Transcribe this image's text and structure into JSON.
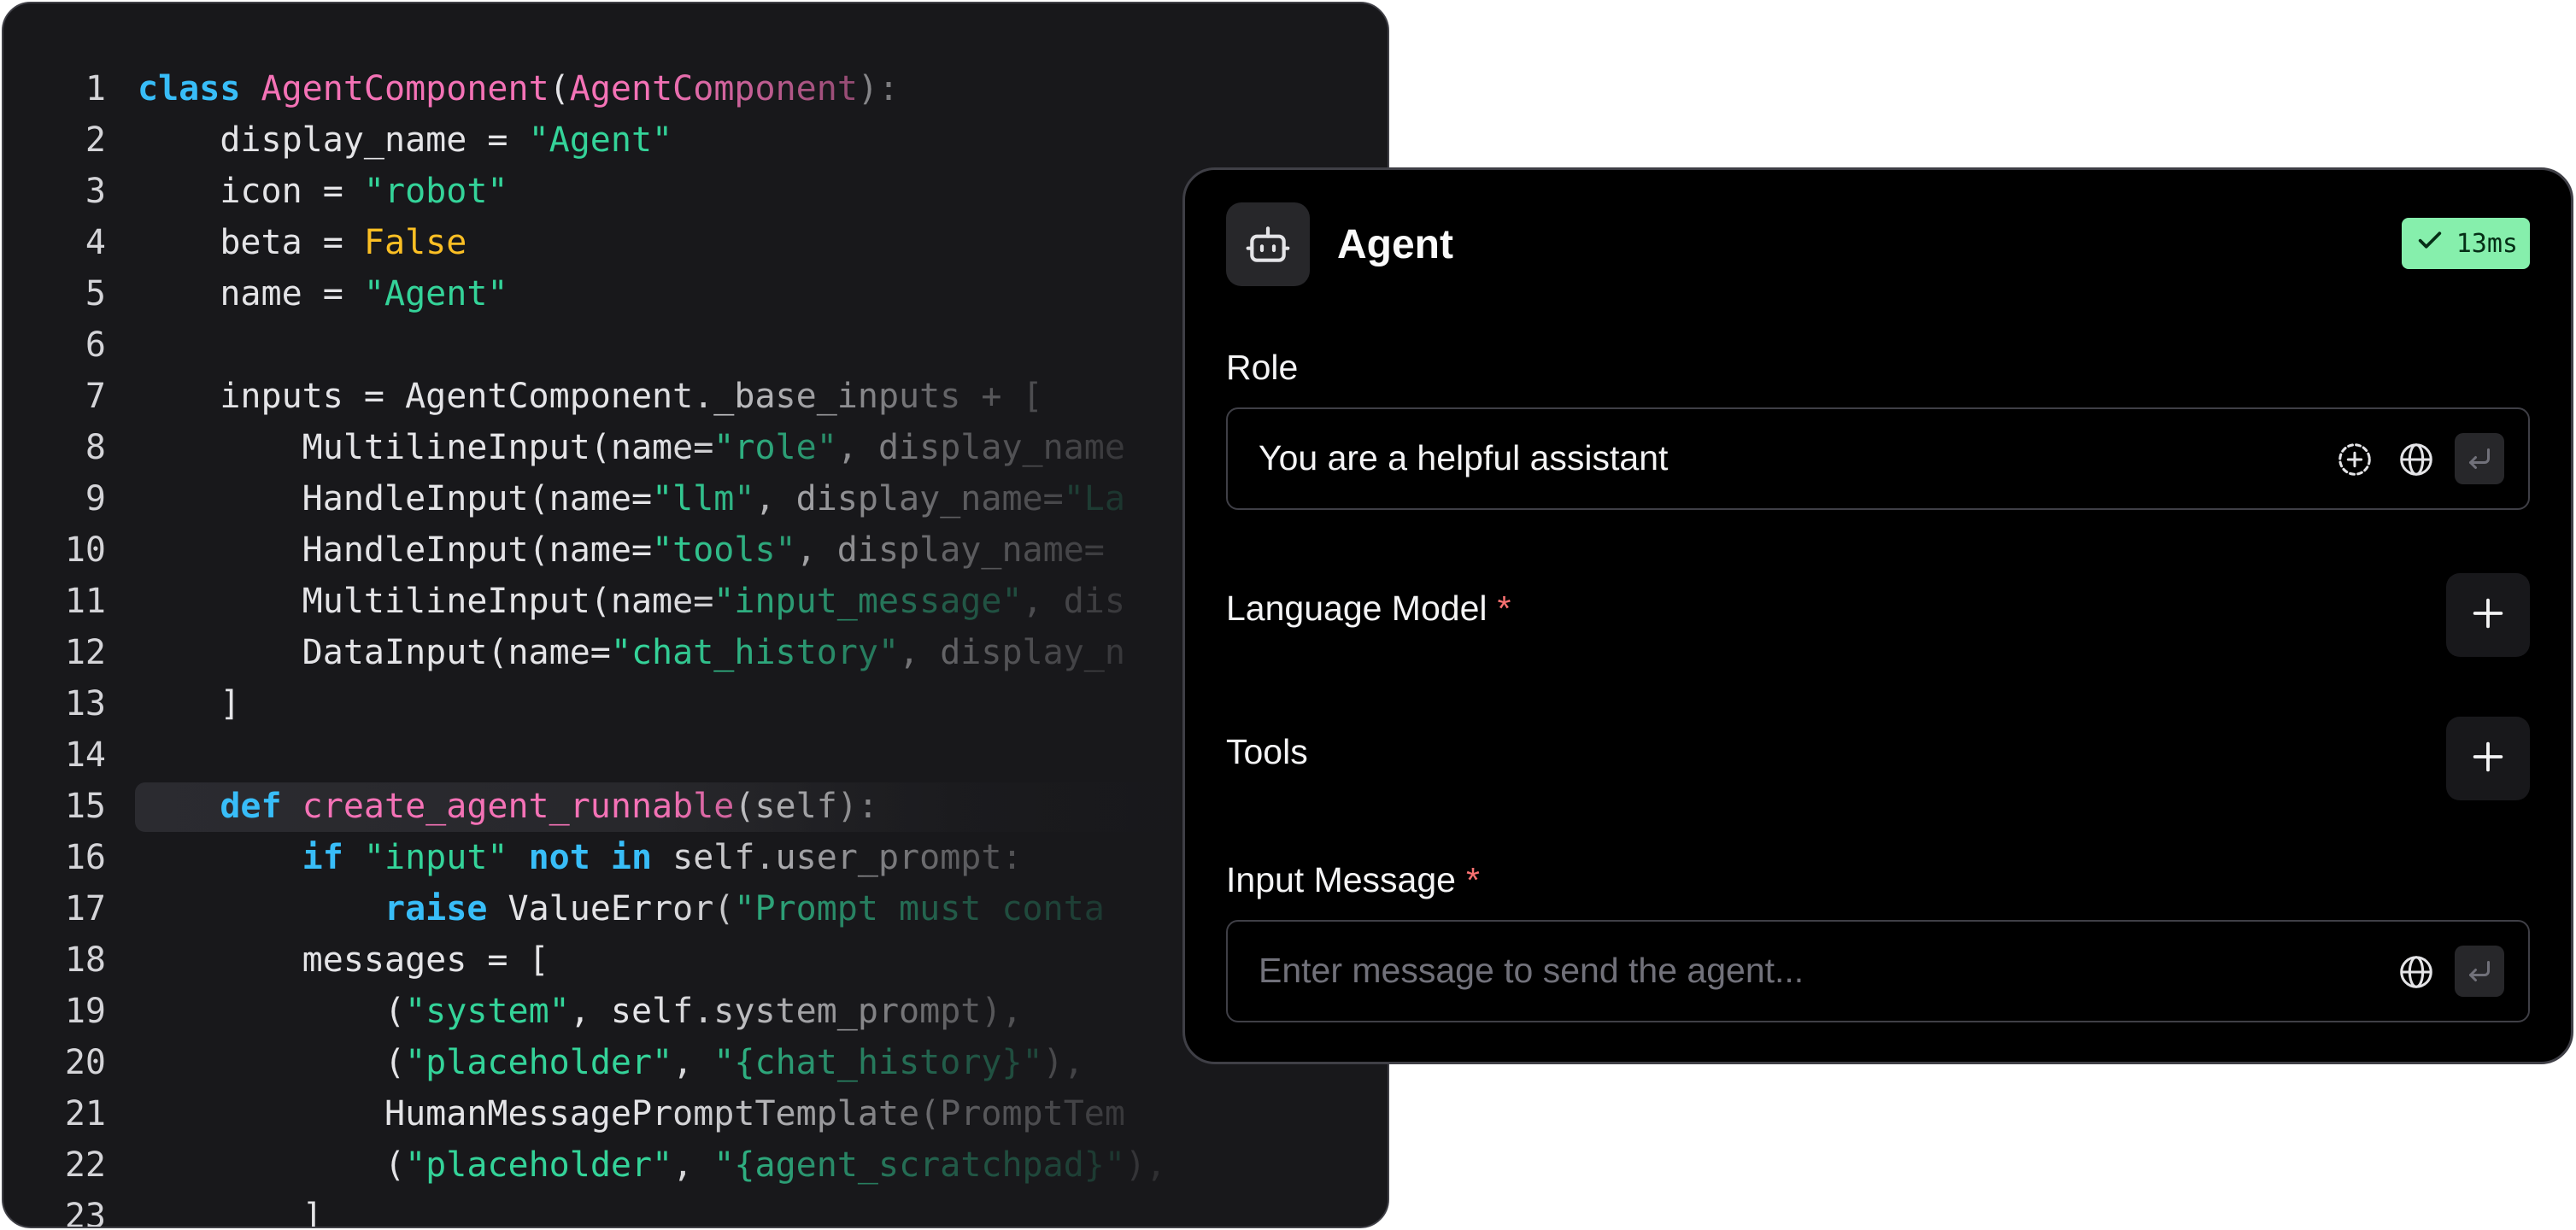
{
  "code": {
    "lines": [
      {
        "num": "1",
        "tokens": [
          {
            "t": "class ",
            "c": "kw"
          },
          {
            "t": "AgentComponent",
            "c": "fn"
          },
          {
            "t": "(",
            "c": "pl"
          },
          {
            "t": "AgentComponent",
            "c": "fn"
          },
          {
            "t": "):",
            "c": "pl"
          }
        ]
      },
      {
        "num": "2",
        "tokens": [
          {
            "t": "    display_name = ",
            "c": "pl"
          },
          {
            "t": "\"Agent\"",
            "c": "st"
          }
        ]
      },
      {
        "num": "3",
        "tokens": [
          {
            "t": "    icon = ",
            "c": "pl"
          },
          {
            "t": "\"robot\"",
            "c": "st"
          }
        ]
      },
      {
        "num": "4",
        "tokens": [
          {
            "t": "    beta = ",
            "c": "pl"
          },
          {
            "t": "False",
            "c": "bl"
          }
        ]
      },
      {
        "num": "5",
        "tokens": [
          {
            "t": "    name = ",
            "c": "pl"
          },
          {
            "t": "\"Agent\"",
            "c": "st"
          }
        ]
      },
      {
        "num": "6",
        "tokens": []
      },
      {
        "num": "7",
        "tokens": [
          {
            "t": "    inputs = AgentComponent._base_inputs + [",
            "c": "pl"
          }
        ]
      },
      {
        "num": "8",
        "tokens": [
          {
            "t": "        MultilineInput(name=",
            "c": "pl"
          },
          {
            "t": "\"role\"",
            "c": "st"
          },
          {
            "t": ", display_name",
            "c": "pl"
          }
        ]
      },
      {
        "num": "9",
        "tokens": [
          {
            "t": "        HandleInput(name=",
            "c": "pl"
          },
          {
            "t": "\"llm\"",
            "c": "st"
          },
          {
            "t": ", display_name=",
            "c": "pl"
          },
          {
            "t": "\"La",
            "c": "st"
          }
        ]
      },
      {
        "num": "10",
        "tokens": [
          {
            "t": "        HandleInput(name=",
            "c": "pl"
          },
          {
            "t": "\"tools\"",
            "c": "st"
          },
          {
            "t": ", display_name=",
            "c": "pl"
          }
        ]
      },
      {
        "num": "11",
        "tokens": [
          {
            "t": "        MultilineInput(name=",
            "c": "pl"
          },
          {
            "t": "\"input_message\"",
            "c": "st"
          },
          {
            "t": ", dis",
            "c": "pl"
          }
        ]
      },
      {
        "num": "12",
        "tokens": [
          {
            "t": "        DataInput(name=",
            "c": "pl"
          },
          {
            "t": "\"chat_history\"",
            "c": "st"
          },
          {
            "t": ", display_n",
            "c": "pl"
          }
        ]
      },
      {
        "num": "13",
        "tokens": [
          {
            "t": "    ]",
            "c": "pl"
          }
        ]
      },
      {
        "num": "14",
        "tokens": []
      },
      {
        "num": "15",
        "highlight": true,
        "tokens": [
          {
            "t": "    def ",
            "c": "kw"
          },
          {
            "t": "create_agent_runnable",
            "c": "fn"
          },
          {
            "t": "(self):",
            "c": "pl"
          }
        ]
      },
      {
        "num": "16",
        "tokens": [
          {
            "t": "        if ",
            "c": "kw"
          },
          {
            "t": "\"input\" ",
            "c": "st"
          },
          {
            "t": "not in ",
            "c": "kw"
          },
          {
            "t": "self.user_prompt:",
            "c": "pl"
          }
        ]
      },
      {
        "num": "17",
        "tokens": [
          {
            "t": "            raise ",
            "c": "kw"
          },
          {
            "t": "ValueError(",
            "c": "pl"
          },
          {
            "t": "\"Prompt must conta",
            "c": "st"
          }
        ]
      },
      {
        "num": "18",
        "tokens": [
          {
            "t": "        messages = [",
            "c": "pl"
          }
        ]
      },
      {
        "num": "19",
        "tokens": [
          {
            "t": "            (",
            "c": "pl"
          },
          {
            "t": "\"system\"",
            "c": "st"
          },
          {
            "t": ", self.system_prompt),",
            "c": "pl"
          }
        ]
      },
      {
        "num": "20",
        "tokens": [
          {
            "t": "            (",
            "c": "pl"
          },
          {
            "t": "\"placeholder\"",
            "c": "st"
          },
          {
            "t": ", ",
            "c": "pl"
          },
          {
            "t": "\"{chat_history}\"",
            "c": "st"
          },
          {
            "t": "),",
            "c": "pl"
          }
        ]
      },
      {
        "num": "21",
        "tokens": [
          {
            "t": "            HumanMessagePromptTemplate(PromptTem",
            "c": "pl"
          }
        ]
      },
      {
        "num": "22",
        "tokens": [
          {
            "t": "            (",
            "c": "pl"
          },
          {
            "t": "\"placeholder\"",
            "c": "st"
          },
          {
            "t": ", ",
            "c": "pl"
          },
          {
            "t": "\"{agent_scratchpad}\"",
            "c": "st"
          },
          {
            "t": "),",
            "c": "pl"
          }
        ]
      },
      {
        "num": "23",
        "tokens": [
          {
            "t": "        ]",
            "c": "pl"
          }
        ]
      }
    ]
  },
  "agent": {
    "title": "Agent",
    "icon": "robot-icon",
    "time_badge": "13ms",
    "role": {
      "label": "Role",
      "value": "You are a helpful assistant"
    },
    "language_model": {
      "label": "Language Model",
      "required_marker": "*"
    },
    "tools": {
      "label": "Tools"
    },
    "input_message": {
      "label": "Input Message",
      "required_marker": "*",
      "placeholder": "Enter message to send the agent..."
    }
  },
  "colors": {
    "keyword": "#38bdf8",
    "function": "#f472b6",
    "string": "#34d399",
    "boolean": "#fbbf24",
    "badge": "#86efac",
    "required": "#f87171"
  }
}
